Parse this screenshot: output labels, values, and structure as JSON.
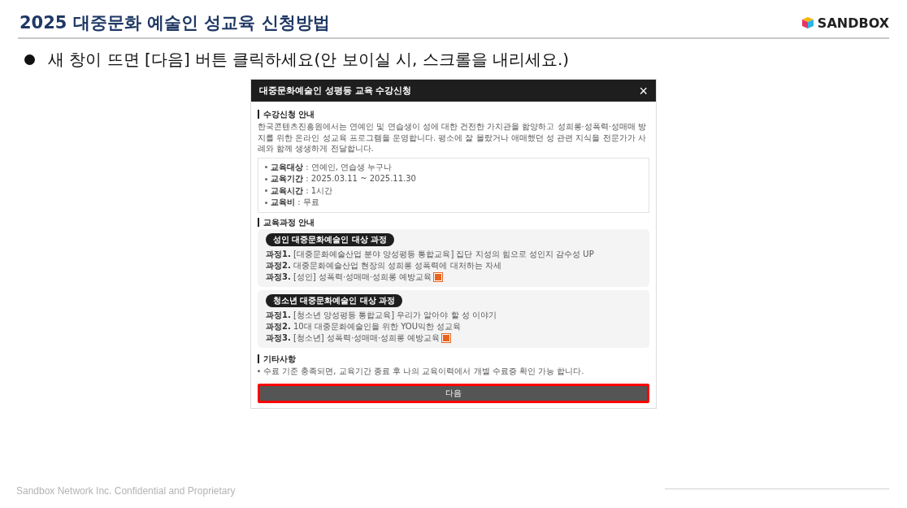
{
  "slide": {
    "title": "2025 대중문화 예술인 성교육 신청방법",
    "logo": "SANDBOX",
    "instruction": "새 창이 뜨면 [다음] 버튼 클릭하세요(안 보이실 시, 스크롤을 내리세요.)",
    "footer": "Sandbox Network Inc. Confidential and Proprietary"
  },
  "dialog": {
    "title": "대중문화예술인 성평등 교육 수강신청",
    "close": "×",
    "intro": {
      "heading": "수강신청 안내",
      "text": "한국콘텐츠진흥원에서는 연예인 및 연습생이 성에 대한 건전한 가치관을 함양하고 성희롱·성폭력·성매매 방지를 위한 온라인 성교육 프로그램을 운영합니다. 평소에 잘 몰랐거나 애매했던 성 관련 지식을 전문가가 사례와 함께 생생하게 전달합니다.",
      "facts": [
        "**교육대상** : 연예인, 연습생 누구나",
        "**교육기간** : 2025.03.11 ~ 2025.11.30",
        "**교육시간** : 1시간",
        "**교육비** : 무료"
      ]
    },
    "courses_heading": "교육과정 안내",
    "groups": [
      {
        "badge": "성인 대중문화예술인 대상 과정",
        "courses": [
          {
            "label": "과정1.",
            "text": "[대중문화예술산업 분야 양성평등 통합교육] 집단 지성의 힘으로 성인지 감수성 UP",
            "new": false
          },
          {
            "label": "과정2.",
            "text": "대중문화예술산업 현장의 성희롱 성폭력에 대처하는 자세",
            "new": false
          },
          {
            "label": "과정3.",
            "text": "[성인] 성폭력·성매매·성희롱 예방교육",
            "new": true
          }
        ]
      },
      {
        "badge": "청소년 대중문화예술인 대상 과정",
        "courses": [
          {
            "label": "과정1.",
            "text": "[청소년 양성평등 통합교육] 우리가 알아야 할 성 이야기",
            "new": false
          },
          {
            "label": "과정2.",
            "text": "10대 대중문화예술인을 위한 YOU익한 성교육",
            "new": false
          },
          {
            "label": "과정3.",
            "text": "[청소년] 성폭력·성매매·성희롱 예방교육",
            "new": true
          }
        ]
      }
    ],
    "other": {
      "heading": "기타사항",
      "note": "수료 기준 충족되면, 교육기간 종료 후 나의 교육이력에서 개별 수료증 확인 가능 합니다."
    },
    "next_button": {
      "label": "다음",
      "highlighted": true
    }
  }
}
